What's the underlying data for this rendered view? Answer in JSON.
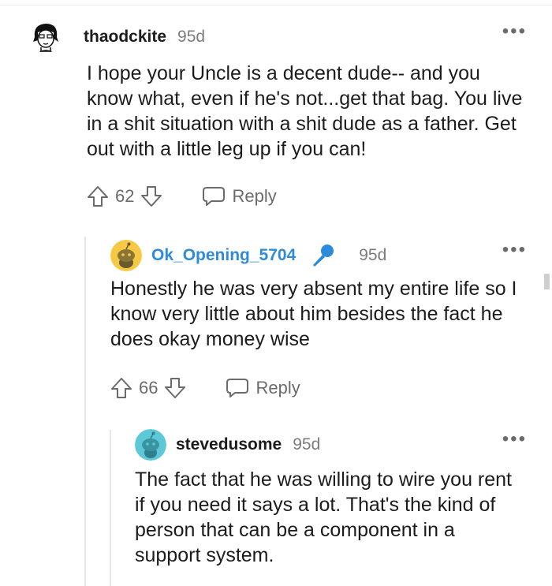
{
  "comments": [
    {
      "username": "thaodckite",
      "age": "95d",
      "body": "I hope your Uncle is a decent dude-- and you know what, even if he's not...get that bag. You live in a shit situation with a shit dude as a father. Get out with a little leg up if you can!",
      "votes": "62",
      "reply_label": "Reply",
      "more_label": "•••",
      "avatar": "character-sketch-avatar"
    },
    {
      "username": "Ok_Opening_5704",
      "age": "95d",
      "body": "Honestly he was very absent my entire life so I know very little about him besides the fact he does okay money wise",
      "votes": "66",
      "reply_label": "Reply",
      "more_label": "•••",
      "avatar": "yellow-snoo-avatar",
      "badge": "microphone-icon",
      "is_op": true
    },
    {
      "username": "stevedusome",
      "age": "95d",
      "body": "The fact that he was willing to wire you rent if you need it says a lot. That's the kind of person that can be a component in a support system.",
      "more_label": "•••",
      "avatar": "teal-snoo-avatar"
    }
  ],
  "colors": {
    "op_username": "#2e8bd8",
    "meta_gray": "#7c7c7c",
    "thread_line": "#e6e6e6"
  }
}
